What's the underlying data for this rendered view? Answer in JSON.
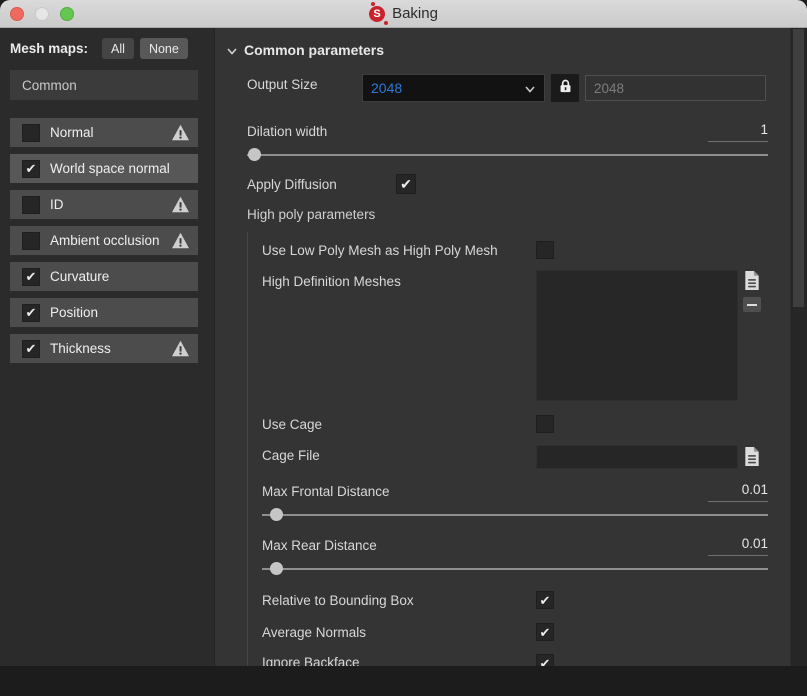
{
  "window": {
    "title": "Baking",
    "controls": {
      "close": "close-button",
      "minimize": "minimize-button",
      "zoom": "zoom-button"
    }
  },
  "sidebar": {
    "header_label": "Mesh maps:",
    "select_all_label": "All",
    "select_none_label": "None",
    "preset_name": "Common",
    "maps": [
      {
        "label": "Normal",
        "checked": false,
        "warning": true,
        "selected": false
      },
      {
        "label": "World space normal",
        "checked": true,
        "warning": false,
        "selected": true
      },
      {
        "label": "ID",
        "checked": false,
        "warning": true,
        "selected": false
      },
      {
        "label": "Ambient occlusion",
        "checked": false,
        "warning": true,
        "selected": false
      },
      {
        "label": "Curvature",
        "checked": true,
        "warning": false,
        "selected": false
      },
      {
        "label": "Position",
        "checked": true,
        "warning": false,
        "selected": false
      },
      {
        "label": "Thickness",
        "checked": true,
        "warning": true,
        "selected": false
      }
    ]
  },
  "main": {
    "section_title": "Common parameters",
    "output_size": {
      "label": "Output Size",
      "value": "2048",
      "linked_value": "2048",
      "locked": true
    },
    "dilation": {
      "label": "Dilation width",
      "value": "1",
      "slider_pos_pct": 1.3
    },
    "apply_diffusion": {
      "label": "Apply Diffusion",
      "checked": true
    },
    "high_poly": {
      "title": "High poly parameters",
      "use_low_poly": {
        "label": "Use Low Poly Mesh as High Poly Mesh",
        "checked": false
      },
      "high_def_meshes": {
        "label": "High Definition Meshes",
        "items": []
      },
      "use_cage": {
        "label": "Use Cage",
        "checked": false
      },
      "cage_file": {
        "label": "Cage File",
        "value": ""
      },
      "max_frontal": {
        "label": "Max Frontal Distance",
        "value": "0.01",
        "slider_pos_pct": 2.8
      },
      "max_rear": {
        "label": "Max Rear Distance",
        "value": "0.01",
        "slider_pos_pct": 2.8
      },
      "relative_bbox": {
        "label": "Relative to Bounding Box",
        "checked": true
      },
      "average_normals": {
        "label": "Average Normals",
        "checked": true
      },
      "ignore_backface": {
        "label": "Ignore Backface",
        "checked": true
      }
    }
  },
  "colors": {
    "accent_blue": "#2e79d9",
    "logo_red": "#c9242e",
    "warning_icon": "#cfcfcf",
    "titlebar": "#d4d4d4",
    "sidebar_bg": "#2b2b2b",
    "panel_bg": "#343434"
  }
}
